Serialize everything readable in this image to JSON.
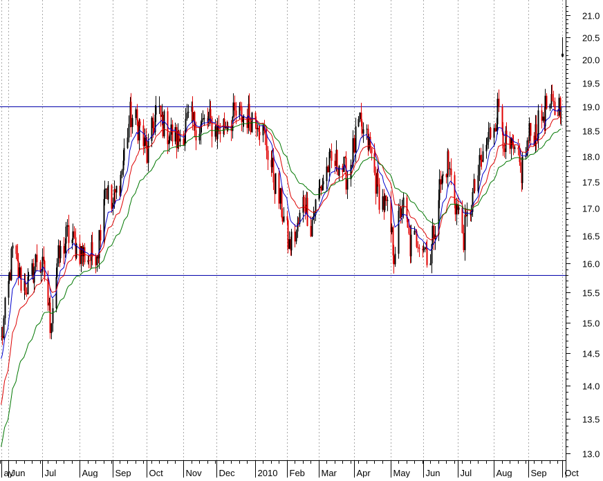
{
  "chart_data": {
    "type": "candlestick",
    "title": "",
    "xlabel": "",
    "ylabel": "",
    "x_range": [
      "2009-05-25",
      "2010-10-04"
    ],
    "ylim": [
      12.9,
      21.35
    ],
    "y_scale": "log",
    "y_axis_position": "right",
    "y_ticks": [
      13.0,
      13.5,
      14.0,
      14.5,
      15.0,
      15.5,
      16.0,
      16.5,
      17.0,
      17.5,
      18.0,
      18.5,
      19.0,
      19.5,
      20.0,
      20.5,
      21.0
    ],
    "y_tick_labels": [
      "13.0",
      "13.5",
      "14.0",
      "14.5",
      "15.0",
      "15.5",
      "16.0",
      "16.5",
      "17.0",
      "17.5",
      "18.0",
      "18.5",
      "19.0",
      "19.5",
      "20.0",
      "20.5",
      "21.0"
    ],
    "x_ticks": [
      {
        "label": "ay",
        "date": "2009-05-26"
      },
      {
        "label": "Jun",
        "date": "2009-06-01"
      },
      {
        "label": "Jul",
        "date": "2009-07-01"
      },
      {
        "label": "Aug",
        "date": "2009-08-03"
      },
      {
        "label": "Sep",
        "date": "2009-09-01"
      },
      {
        "label": "Oct",
        "date": "2009-10-01"
      },
      {
        "label": "Nov",
        "date": "2009-11-02"
      },
      {
        "label": "Dec",
        "date": "2009-12-01"
      },
      {
        "label": "2010",
        "date": "2010-01-04"
      },
      {
        "label": "Feb",
        "date": "2010-02-01"
      },
      {
        "label": "Mar",
        "date": "2010-03-01"
      },
      {
        "label": "Apr",
        "date": "2010-04-01"
      },
      {
        "label": "May",
        "date": "2010-05-03"
      },
      {
        "label": "Jun",
        "date": "2010-06-01"
      },
      {
        "label": "Jul",
        "date": "2010-07-01"
      },
      {
        "label": "Aug",
        "date": "2010-08-02"
      },
      {
        "label": "Sep",
        "date": "2010-09-01"
      },
      {
        "label": "Oct",
        "date": "2010-10-01"
      }
    ],
    "grid": {
      "vertical": true,
      "horizontal": false,
      "style": "dotted"
    },
    "horizontal_lines": [
      {
        "y": 19.0,
        "color": "#0000aa"
      },
      {
        "y": 15.8,
        "color": "#0000aa"
      }
    ],
    "colors": {
      "up": "#000000",
      "down": "#e00000",
      "ma_fast": "#0000cc",
      "ma_mid": "#dd0000",
      "ma_slow": "#007700"
    },
    "price_path": [
      [
        "2009-05-26",
        14.7
      ],
      [
        "2009-06-05",
        16.2
      ],
      [
        "2009-06-12",
        15.7
      ],
      [
        "2009-06-19",
        15.6
      ],
      [
        "2009-06-26",
        16.1
      ],
      [
        "2009-07-03",
        15.8
      ],
      [
        "2009-07-08",
        15.0
      ],
      [
        "2009-07-14",
        16.0
      ],
      [
        "2009-07-23",
        16.5
      ],
      [
        "2009-08-04",
        16.2
      ],
      [
        "2009-08-12",
        16.1
      ],
      [
        "2009-08-19",
        16.3
      ],
      [
        "2009-08-25",
        17.5
      ],
      [
        "2009-08-31",
        17.0
      ],
      [
        "2009-09-08",
        17.6
      ],
      [
        "2009-09-16",
        18.8
      ],
      [
        "2009-09-24",
        18.6
      ],
      [
        "2009-10-01",
        18.0
      ],
      [
        "2009-10-09",
        18.9
      ],
      [
        "2009-10-19",
        18.5
      ],
      [
        "2009-10-28",
        18.3
      ],
      [
        "2009-11-06",
        18.7
      ],
      [
        "2009-11-16",
        18.6
      ],
      [
        "2009-11-24",
        18.7
      ],
      [
        "2009-12-02",
        18.5
      ],
      [
        "2009-12-10",
        18.7
      ],
      [
        "2009-12-18",
        18.8
      ],
      [
        "2010-01-06",
        18.8
      ],
      [
        "2010-01-13",
        18.3
      ],
      [
        "2010-01-20",
        17.6
      ],
      [
        "2010-01-27",
        17.0
      ],
      [
        "2010-02-03",
        16.3
      ],
      [
        "2010-02-10",
        16.6
      ],
      [
        "2010-02-16",
        17.2
      ],
      [
        "2010-02-22",
        16.7
      ],
      [
        "2010-03-01",
        17.3
      ],
      [
        "2010-03-09",
        17.8
      ],
      [
        "2010-03-18",
        17.9
      ],
      [
        "2010-03-26",
        17.6
      ],
      [
        "2010-04-05",
        18.6
      ],
      [
        "2010-04-14",
        18.2
      ],
      [
        "2010-04-22",
        17.3
      ],
      [
        "2010-04-29",
        17.0
      ],
      [
        "2010-05-06",
        16.2
      ],
      [
        "2010-05-13",
        17.1
      ],
      [
        "2010-05-20",
        16.3
      ],
      [
        "2010-05-28",
        16.5
      ],
      [
        "2010-06-07",
        16.1
      ],
      [
        "2010-06-14",
        17.3
      ],
      [
        "2010-06-22",
        17.9
      ],
      [
        "2010-06-28",
        17.2
      ],
      [
        "2010-07-06",
        16.5
      ],
      [
        "2010-07-14",
        17.2
      ],
      [
        "2010-07-22",
        17.9
      ],
      [
        "2010-07-30",
        18.5
      ],
      [
        "2010-08-06",
        19.0
      ],
      [
        "2010-08-12",
        18.2
      ],
      [
        "2010-08-19",
        18.0
      ],
      [
        "2010-08-26",
        17.7
      ],
      [
        "2010-09-02",
        18.4
      ],
      [
        "2010-09-10",
        18.6
      ],
      [
        "2010-09-17",
        19.0
      ],
      [
        "2010-09-24",
        18.9
      ],
      [
        "2010-09-30",
        19.1
      ]
    ],
    "last_bar": {
      "date": "2010-10-01",
      "open": 20.1,
      "high": 20.5,
      "low": 20.05,
      "close": 20.1
    }
  }
}
